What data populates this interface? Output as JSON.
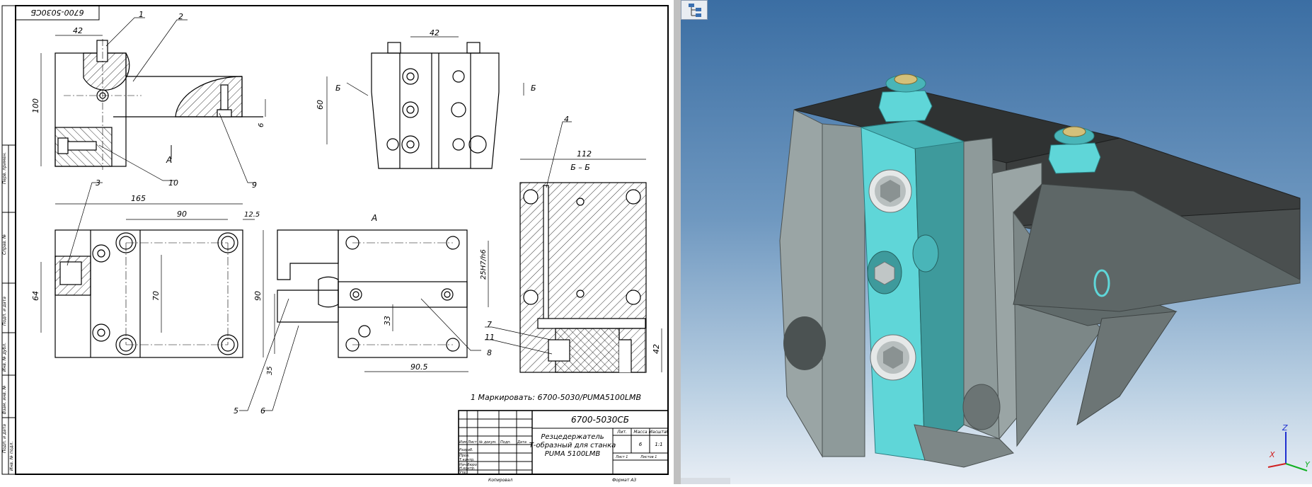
{
  "drawing": {
    "stamp_number": "6700-5030СБ",
    "title_lines": [
      "Резцедержатель",
      "Т-образный для станка",
      "PUMA 5100LMB"
    ],
    "note": "1 Маркировать: 6700-5030/PUMA5100LMB",
    "format_label": "Формат  А3",
    "copied_label": "Копировал",
    "table_headers": [
      "Изм",
      "Лист",
      "№ докум.",
      "Подп.",
      "Дата"
    ],
    "table_rows": [
      "Разраб.",
      "Пров.",
      "Т.контр.",
      "Нач.бюро",
      "Н.контр.",
      "Утв."
    ],
    "lit_header": "Лит.",
    "mass_header": "Масса",
    "scale_header": "Масштаб",
    "mass_value": "6",
    "scale_value": "1:1",
    "sheet_label": "Лист 1",
    "sheets_label": "Листов 1",
    "side_labels": [
      "Перв. примен.",
      "Справ. №",
      "Подп. и дата",
      "Инв. № дубл.",
      "Взам. инв. №",
      "Подп. и дата",
      "Инв. № подл."
    ],
    "dims": {
      "d42a": "42",
      "d100": "100",
      "d6": "6",
      "d42b": "42",
      "d60": "60",
      "d165": "165",
      "d90a": "90",
      "d125": "12.5",
      "d64": "64",
      "d70": "70",
      "d90b": "90",
      "d33": "33",
      "d905": "90.5",
      "d25": "25H7/h6",
      "d35": "35",
      "d112": "112",
      "d42c": "42"
    },
    "callouts": [
      "1",
      "2",
      "3",
      "4",
      "5",
      "6",
      "7",
      "8",
      "9",
      "10",
      "11"
    ],
    "view_a_label": "А",
    "section_label": "Б – Б",
    "section_mark": "Б",
    "arrow_a": "А"
  },
  "viewer": {
    "axis_x": "X",
    "axis_y": "Y",
    "axis_z": "Z",
    "colors": {
      "cyan": "#5fd6d8",
      "gray": "#8e9a9a",
      "dark": "#3a3d3d"
    }
  }
}
